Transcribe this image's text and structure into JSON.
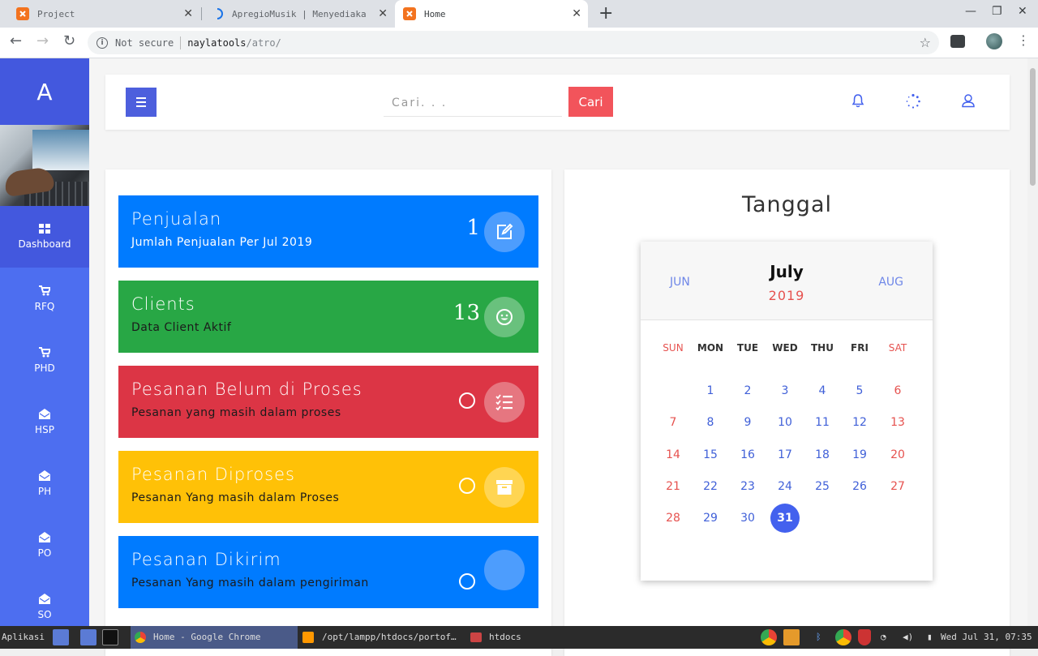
{
  "browser": {
    "tabs": [
      {
        "label": "Project",
        "active": false
      },
      {
        "label": "ApregioMusik | Menyediaka",
        "active": false
      },
      {
        "label": "Home",
        "active": true
      }
    ],
    "url": {
      "security": "Not secure",
      "host": "naylatools",
      "path": "/atro/"
    }
  },
  "sidebar": {
    "logo": "A",
    "items": [
      {
        "label": "Dashboard",
        "icon": "grid-icon",
        "active": true
      },
      {
        "label": "RFQ",
        "icon": "cart-icon"
      },
      {
        "label": "PHD",
        "icon": "cart-icon"
      },
      {
        "label": "HSP",
        "icon": "envelope-open-icon"
      },
      {
        "label": "PH",
        "icon": "envelope-open-icon"
      },
      {
        "label": "PO",
        "icon": "envelope-open-icon"
      },
      {
        "label": "SO",
        "icon": "envelope-open-icon"
      }
    ]
  },
  "topbar": {
    "search_placeholder": "Cari. . .",
    "search_button": "Cari"
  },
  "stats": [
    {
      "title": "Penjualan",
      "subtitle": "Jumlah Penjualan Per Jul 2019",
      "value": "1",
      "color": "#007bff",
      "icon": "edit-icon"
    },
    {
      "title": "Clients",
      "subtitle": "Data Client Aktif",
      "value": "13",
      "color": "#28a745",
      "icon": "smile-icon"
    },
    {
      "title": "Pesanan Belum di Proses",
      "subtitle": "Pesanan yang masih dalam proses",
      "value": "0",
      "color": "#dc3545",
      "icon": "list-check-icon"
    },
    {
      "title": "Pesanan Diproses",
      "subtitle": "Pesanan Yang masih dalam Proses",
      "value": "0",
      "color": "#ffc107",
      "icon": "archive-icon"
    },
    {
      "title": "Pesanan Dikirim",
      "subtitle": "Pesanan Yang masih dalam pengiriman",
      "value": "0",
      "color": "#007bff",
      "icon": "truck-icon"
    }
  ],
  "calendar": {
    "heading": "Tanggal",
    "prev_month": "JUN",
    "month": "July",
    "year": "2019",
    "next_month": "AUG",
    "weekdays": [
      "SUN",
      "MON",
      "TUE",
      "WED",
      "THU",
      "FRI",
      "SAT"
    ],
    "today": 31
  },
  "taskbar": {
    "menu": "Aplikasi",
    "apps": [
      "Home - Google Chrome",
      "/opt/lampp/htdocs/portof…",
      "htdocs"
    ],
    "clock": "Wed Jul 31, 07:35"
  }
}
